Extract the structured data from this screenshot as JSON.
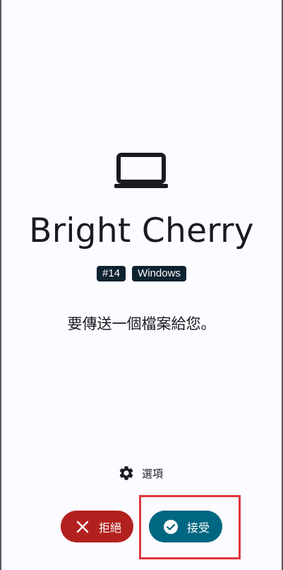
{
  "device": {
    "icon": "laptop-icon",
    "name": "Bright Cherry",
    "badges": [
      "#14",
      "Windows"
    ]
  },
  "message": "要傳送一個檔案給您。",
  "options": {
    "icon": "gear-icon",
    "label": "選項"
  },
  "actions": {
    "decline": {
      "icon": "close-icon",
      "label": "拒絕",
      "color": "#b3211e"
    },
    "accept": {
      "icon": "check-circle-icon",
      "label": "接受",
      "color": "#006782"
    }
  },
  "colors": {
    "background": "#fcfbff",
    "badge": "#0f2230",
    "highlight": "#e0363b"
  }
}
